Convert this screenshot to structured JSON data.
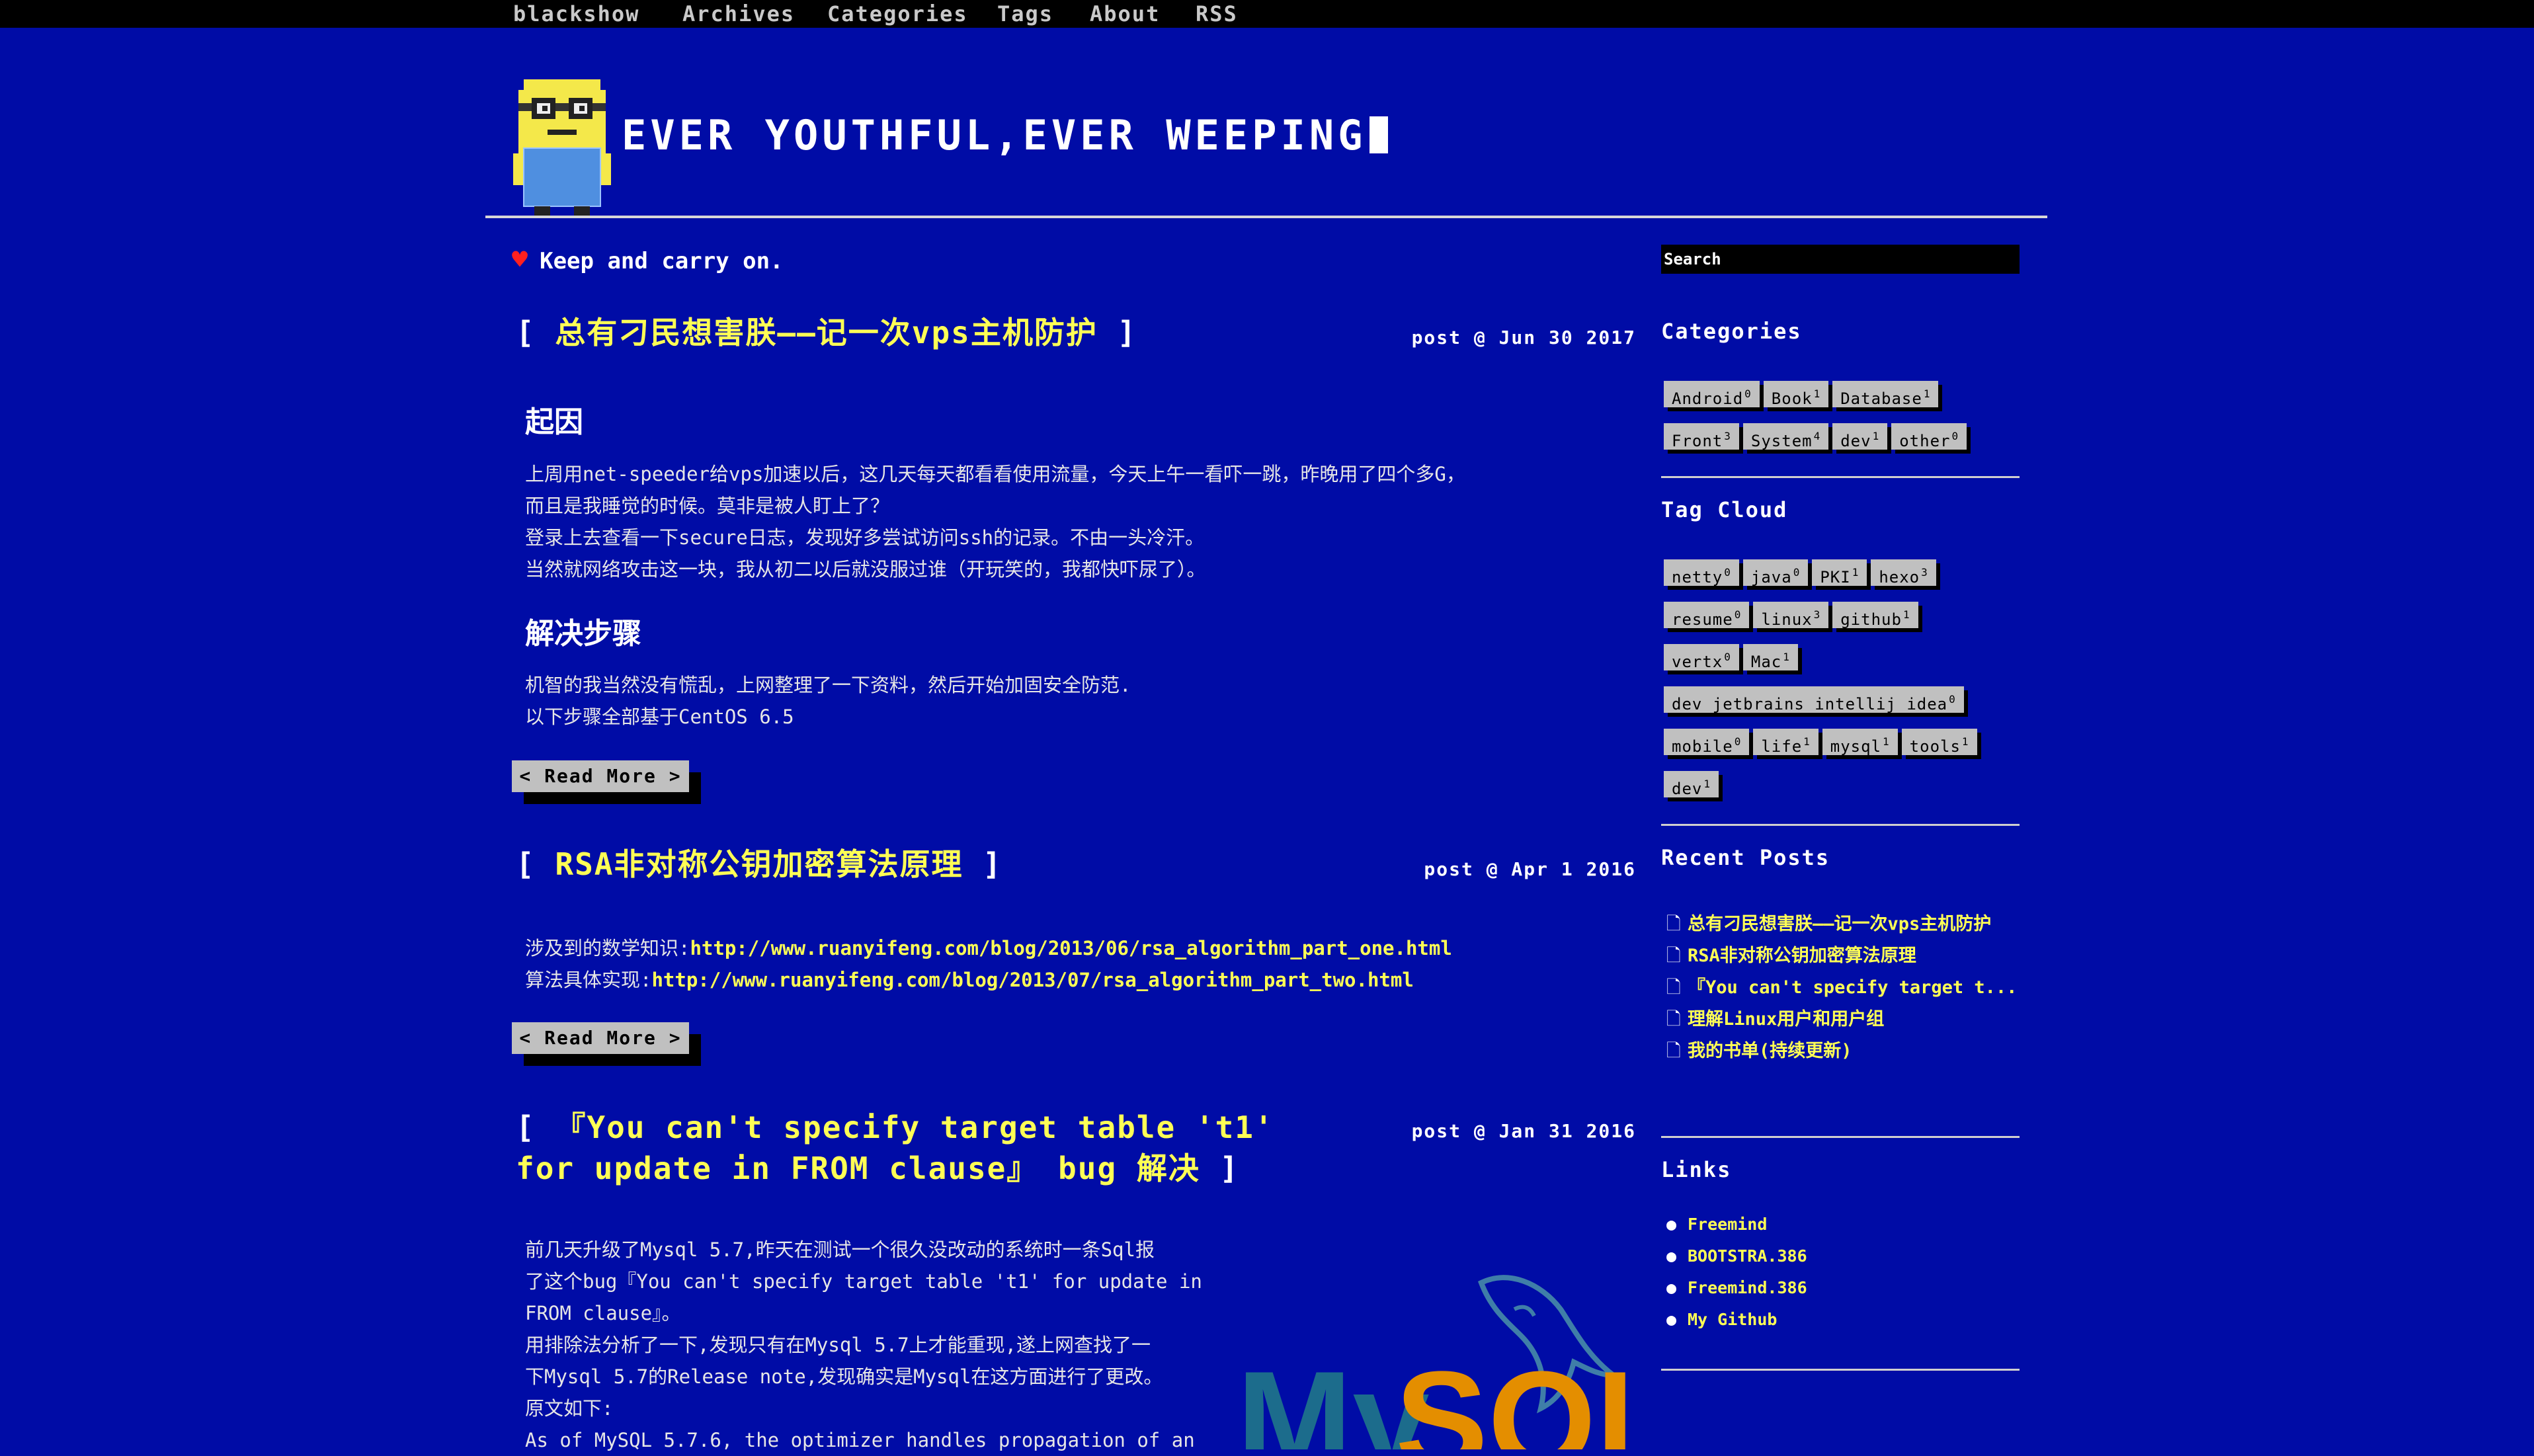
{
  "nav": {
    "brand": "blackshow",
    "items": [
      "Archives",
      "Categories",
      "Tags",
      "About",
      "RSS"
    ]
  },
  "header": {
    "title": "EVER YOUTHFUL,EVER WEEPING"
  },
  "motto": "Keep and carry on.",
  "posts": [
    {
      "title": "总有刁民想害朕——记一次vps主机防护",
      "date": "post @ Jun 30 2017",
      "h_reason": "起因",
      "reason": [
        "上周用net-speeder给vps加速以后，这几天每天都看看使用流量，今天上午一看吓一跳，昨晚用了四个多G，",
        "而且是我睡觉的时候。莫非是被人盯上了？",
        "登录上去查看一下secure日志，发现好多尝试访问ssh的记录。不由一头冷汗。",
        "当然就网络攻击这一块，我从初二以后就没服过谁（开玩笑的，我都快吓尿了）。"
      ],
      "h_steps": "解决步骤",
      "steps": [
        "机智的我当然没有慌乱，上网整理了一下资料，然后开始加固安全防范.",
        "以下步骤全部基于CentOS 6.5"
      ],
      "read_more": "< Read More >"
    },
    {
      "title": "RSA非对称公钥加密算法原理",
      "date": "post @ Apr 1 2016",
      "line1_label": "涉及到的数学知识:",
      "line1_link": "http://www.ruanyifeng.com/blog/2013/06/rsa_algorithm_part_one.html",
      "line2_label": "算法具体实现:",
      "line2_link": "http://www.ruanyifeng.com/blog/2013/07/rsa_algorithm_part_two.html",
      "read_more": "< Read More >"
    },
    {
      "title_line1": "『You can't specify target table 't1'",
      "title_line2": "for update in FROM clause』 bug 解决",
      "date": "post @ Jan 31 2016",
      "body": [
        "前几天升级了Mysql 5.7,昨天在测试一个很久没改动的系统时一条Sql报",
        "了这个bug『You can't specify target table 't1' for update in",
        "FROM clause』。",
        "用排除法分析了一下,发现只有在Mysql 5.7上才能重现,遂上网查找了一",
        "下Mysql 5.7的Release note,发现确实是Mysql在这方面进行了更改。",
        "原文如下:",
        "As of MySQL 5.7.6, the optimizer handles propagation of an"
      ]
    }
  ],
  "sidebar": {
    "search_placeholder": "Search",
    "categories_title": "Categories",
    "categories": [
      {
        "name": "Android",
        "count": "0"
      },
      {
        "name": "Book",
        "count": "1"
      },
      {
        "name": "Database",
        "count": "1"
      },
      {
        "name": "Front",
        "count": "3"
      },
      {
        "name": "System",
        "count": "4"
      },
      {
        "name": "dev",
        "count": "1"
      },
      {
        "name": "other",
        "count": "0"
      }
    ],
    "tagcloud_title": "Tag Cloud",
    "tags": [
      {
        "name": "netty",
        "count": "0"
      },
      {
        "name": "java",
        "count": "0"
      },
      {
        "name": "PKI",
        "count": "1"
      },
      {
        "name": "hexo",
        "count": "3"
      },
      {
        "name": "resume",
        "count": "0"
      },
      {
        "name": "linux",
        "count": "3"
      },
      {
        "name": "github",
        "count": "1"
      },
      {
        "name": "vertx",
        "count": "0"
      },
      {
        "name": "Mac",
        "count": "1"
      },
      {
        "name": "dev jetbrains intellij idea",
        "count": "0"
      },
      {
        "name": "mobile",
        "count": "0"
      },
      {
        "name": "life",
        "count": "1"
      },
      {
        "name": "mysql",
        "count": "1"
      },
      {
        "name": "tools",
        "count": "1"
      },
      {
        "name": "dev",
        "count": "1"
      }
    ],
    "recent_title": "Recent Posts",
    "recent": [
      "总有刁民想害朕——记一次vps主机防护",
      "RSA非对称公钥加密算法原理",
      "『You can't specify target t...",
      "理解Linux用户和用户组",
      "我的书单(持续更新)"
    ],
    "links_title": "Links",
    "links": [
      "Freemind",
      "BOOTSTRA.386",
      "Freemind.386",
      "My Github"
    ]
  },
  "colors": {
    "background": "#000ca6",
    "title_yellow": "#ffff55",
    "nav_bg": "#000000",
    "tag_bg": "#c0c0c0"
  }
}
